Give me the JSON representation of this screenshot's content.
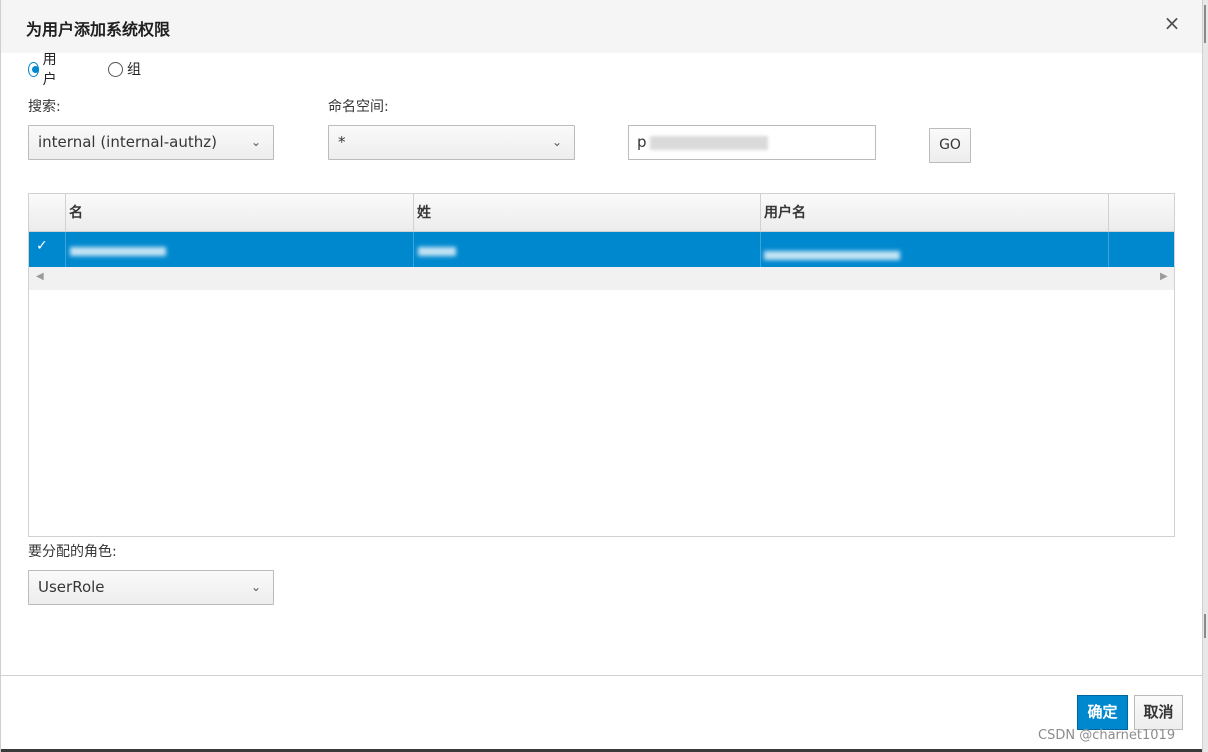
{
  "dialog": {
    "title": "为用户添加系统权限",
    "close_label": "×"
  },
  "principal_type": {
    "options": [
      {
        "label": "用户",
        "selected": true
      },
      {
        "label": "组",
        "selected": false
      }
    ]
  },
  "search": {
    "label": "搜索:",
    "provider_value": "internal (internal-authz)",
    "namespace_label": "命名空间:",
    "namespace_value": "*",
    "query_prefix": "p",
    "go_label": "GO"
  },
  "table": {
    "columns": [
      "名",
      "姓",
      "用户名"
    ],
    "rows": [
      {
        "selected": true
      }
    ]
  },
  "role": {
    "label": "要分配的角色:",
    "value": "UserRole"
  },
  "footer": {
    "ok_label": "确定",
    "cancel_label": "取消"
  },
  "watermark": "CSDN @charnet1019",
  "colors": {
    "accent": "#0088ce",
    "header_bg": "#f5f5f5"
  }
}
